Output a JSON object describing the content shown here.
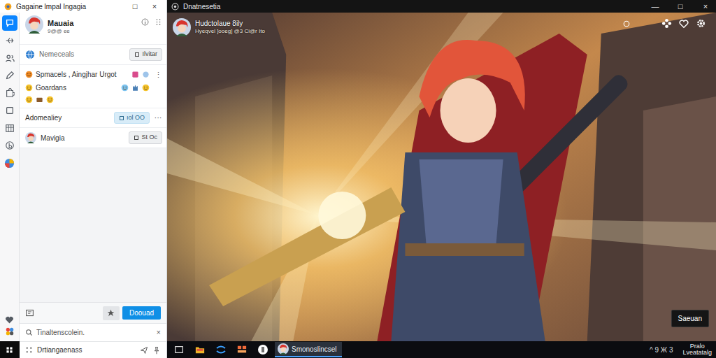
{
  "chat": {
    "title": "Gagaine lmpal Ingagia",
    "controls": [
      "□",
      "×"
    ],
    "rail": [
      {
        "selected": true
      },
      {
        "selected": false
      },
      {
        "selected": false
      },
      {
        "selected": false
      },
      {
        "selected": false
      },
      {
        "selected": false
      },
      {
        "selected": false
      },
      {
        "selected": false
      },
      {
        "selected": false
      }
    ],
    "profile": {
      "name": "Mauaia",
      "status": "9@@ ee"
    },
    "items": [
      {
        "kind": "action",
        "title": "Nemeceals",
        "button": "Ilvitar",
        "active": false,
        "menu": ""
      },
      {
        "kind": "message",
        "title": "Spmacels , Aingjhar Urgot",
        "text": "Goardans",
        "button": "",
        "active": false,
        "menu": "⋮"
      },
      {
        "kind": "action",
        "title": "Adomealiey",
        "button": "ıol OO",
        "active": true,
        "menu": "···"
      },
      {
        "kind": "action",
        "title": "Mavigia",
        "button": "St Oc",
        "active": false,
        "menu": ""
      }
    ],
    "compose": {
      "button": "Doouad"
    },
    "search": {
      "placeholder": "Tinaltenscolein.",
      "clear": "×"
    },
    "footer": {
      "label": "Drtiangaenass"
    }
  },
  "viewer": {
    "title": "Dnatnesetia",
    "controls": [
      "—",
      "□",
      "×"
    ],
    "channel": "Hudctolaue 8ily",
    "meta": "Hyeqvel ]ooeg] @3 Ci@r Ito",
    "button": "Saeuan"
  },
  "taskbar": {
    "pinned": [
      {
        "selected": false
      },
      {
        "selected": false
      },
      {
        "selected": false
      },
      {
        "selected": false
      },
      {
        "selected": false
      }
    ],
    "active_app": {
      "label": "Smonoslincsel",
      "selected": true
    },
    "tray": "^ 9 Ж 3",
    "clock": [
      "Pralo",
      "Lveatatalg"
    ]
  }
}
